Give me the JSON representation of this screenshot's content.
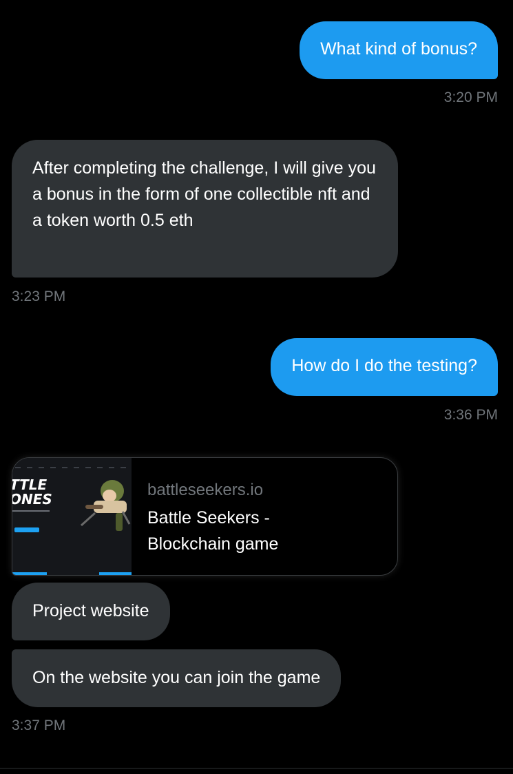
{
  "messages": [
    {
      "id": "m1",
      "direction": "sent",
      "text": "What kind of bonus?",
      "time": "3:20 PM"
    },
    {
      "id": "m2",
      "direction": "received",
      "text": "After completing the challenge, I will give you a bonus in the form of one collectible nft and a token worth 0.5 eth",
      "time": "3:23 PM"
    },
    {
      "id": "m3",
      "direction": "sent",
      "text": "How do I do the testing?",
      "time": "3:36 PM"
    },
    {
      "id": "m4",
      "direction": "received",
      "text": "Project website"
    },
    {
      "id": "m5",
      "direction": "received",
      "text": "On the website you can join the game",
      "time": "3:37 PM"
    }
  ],
  "link_card": {
    "domain": "battleseekers.io",
    "title": "Battle Seekers - Blockchain game",
    "thumbnail": {
      "heading_line1": "TTLE",
      "heading_line2": "ONES"
    }
  },
  "colors": {
    "background": "#000000",
    "sent_bubble": "#1d9bf0",
    "received_bubble": "#2f3336",
    "timestamp": "#71767b",
    "text": "#ffffff"
  }
}
